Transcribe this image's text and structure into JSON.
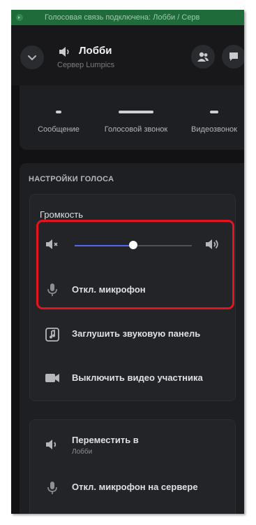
{
  "statusbar": {
    "text": "Голосовая связь подключена: Лобби / Серв"
  },
  "header": {
    "channel_title": "Лобби",
    "server_name": "Сервер Lumpics"
  },
  "actions": [
    {
      "label": "Сообщение",
      "icon": "message-icon"
    },
    {
      "label": "Голосовой звонок",
      "icon": "phone-icon"
    },
    {
      "label": "Видеозвонок",
      "icon": "video-icon"
    }
  ],
  "voice_settings": {
    "section_title": "НАСТРОЙКИ ГОЛОСА",
    "volume_label": "Громкость",
    "volume_level_percent": 50,
    "mute_mic_label": "Откл. микрофон",
    "mute_soundboard_label": "Заглушить звуковую панель",
    "disable_video_label": "Выключить видео участника",
    "move_to_label": "Переместить в",
    "move_to_target": "Лобби",
    "server_mute_label": "Откл. микрофон на сервере"
  },
  "colors": {
    "accent": "#5865f2",
    "highlight": "#e3141f",
    "voice_connected": "#1f6b3a"
  }
}
